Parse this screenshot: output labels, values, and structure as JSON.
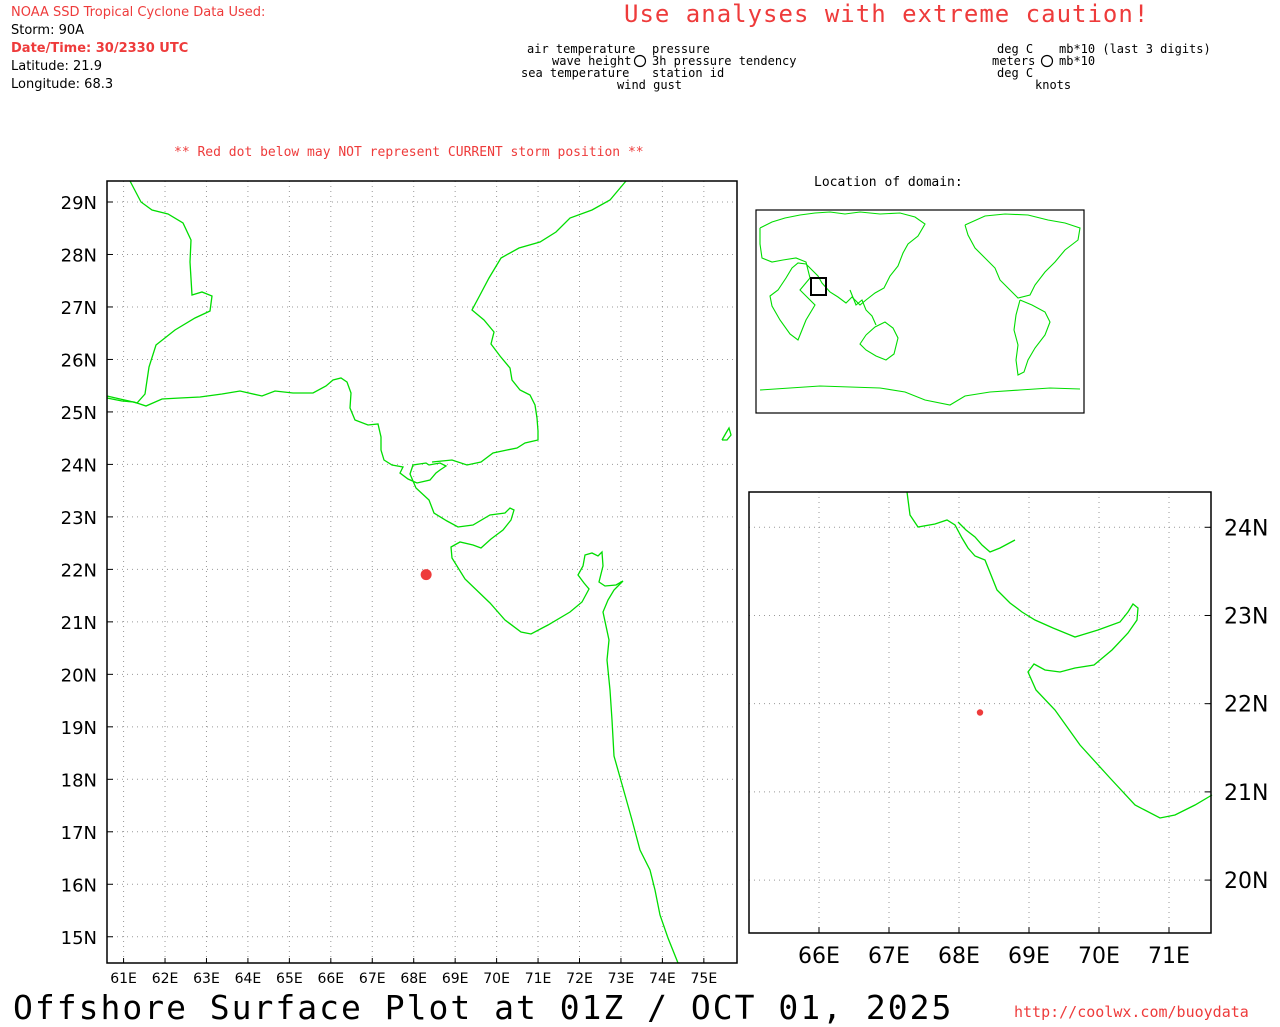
{
  "header": {
    "source": "NOAA SSD Tropical Cyclone Data Used:",
    "storm": "Storm: 90A",
    "datetime": "Date/Time: 30/2330 UTC",
    "latitude": "Latitude: 21.9",
    "longitude": "Longitude: 68.3"
  },
  "caution": "Use analyses with extreme caution!",
  "legend": {
    "left": {
      "tl": "air temperature",
      "ml": "wave height",
      "bl": "sea temperature",
      "tr": "pressure",
      "mr": "3h pressure tendency",
      "br": "station id",
      "bottom": "wind gust"
    },
    "right": {
      "tl": "deg C",
      "ml": "meters",
      "bl": "deg C",
      "tr": "mb*10 (last 3 digits)",
      "mr": "mb*10",
      "bottom": "knots"
    }
  },
  "warning": "** Red dot below may NOT represent CURRENT storm position **",
  "locator_title": "Location of domain:",
  "footer": {
    "title": "Offshore Surface Plot at 01Z / OCT 01, 2025",
    "url": "http://coolwx.com/buoydata"
  },
  "colors": {
    "land": "#00dd00",
    "storm": "#ee3b3b",
    "text_red": "#ee3b3b",
    "grid": "#999999"
  },
  "storm": {
    "lat": 21.9,
    "lon": 68.3
  },
  "main_map": {
    "lon_range": [
      60.6,
      75.8
    ],
    "lat_range": [
      14.5,
      29.4
    ],
    "lon_ticks": [
      "61E",
      "62E",
      "63E",
      "64E",
      "65E",
      "66E",
      "67E",
      "68E",
      "69E",
      "70E",
      "71E",
      "72E",
      "73E",
      "74E",
      "75E"
    ],
    "lat_ticks": [
      "15N",
      "16N",
      "17N",
      "18N",
      "19N",
      "20N",
      "21N",
      "22N",
      "23N",
      "24N",
      "25N",
      "26N",
      "27N",
      "28N",
      "29N"
    ]
  },
  "zoom_map": {
    "lon_range": [
      65.0,
      71.6
    ],
    "lat_range": [
      19.4,
      24.4
    ],
    "lon_ticks": [
      "66E",
      "67E",
      "68E",
      "69E",
      "70E",
      "71E"
    ],
    "lat_ticks": [
      "20N",
      "21N",
      "22N",
      "23N",
      "24N"
    ]
  }
}
